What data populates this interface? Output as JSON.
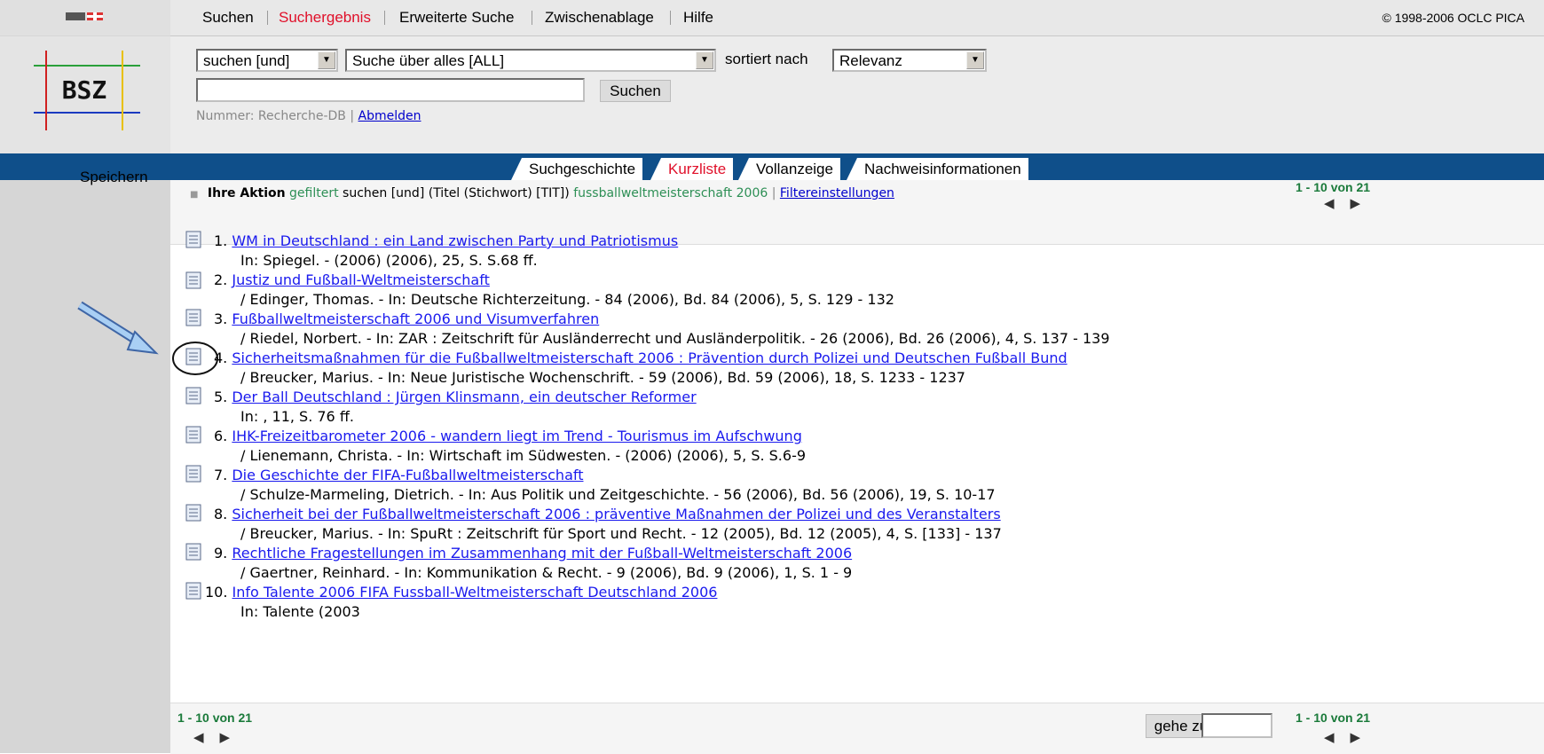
{
  "menu": {
    "items": [
      "Suchen",
      "Suchergebnis",
      "Erweiterte Suche",
      "Zwischenablage",
      "Hilfe"
    ],
    "copyright": "© 1998-2006 OCLC PICA"
  },
  "logo": {
    "text": "BSZ"
  },
  "search": {
    "mode_select": "suchen [und]",
    "index_select": "Suche über alles [ALL]",
    "sort_label": "sortiert nach",
    "sort_select": "Relevanz",
    "query_value": "",
    "search_button": "Suchen",
    "session_label": "Nummer: Recherche-DB |",
    "logout_link": "Abmelden"
  },
  "tabs": [
    "Suchgeschichte",
    "Kurzliste",
    "Vollanzeige",
    "Nachweisinformationen"
  ],
  "sidebar": {
    "save_label": "Speichern"
  },
  "action": {
    "label": "Ihre Aktion",
    "filtered": "gefiltert",
    "query_part": "suchen [und] (Titel (Stichwort) [TIT])",
    "query_term": "fussballweltmeisterschaft 2006",
    "filter_link": "Filtereinstellungen"
  },
  "pager": {
    "text": "1 - 10 von 21",
    "goto_button": "gehe zu",
    "goto_value": ""
  },
  "results": [
    {
      "num": "1.",
      "title": "WM in Deutschland : ein Land zwischen Party und Patriotismus",
      "sub": "In: Spiegel. - (2006) (2006), 25, S. S.68 ff."
    },
    {
      "num": "2.",
      "title": "Justiz und Fußball-Weltmeisterschaft",
      "sub": "/ Edinger, Thomas. - In: Deutsche Richterzeitung. - 84 (2006), Bd. 84 (2006), 5, S. 129 - 132"
    },
    {
      "num": "3.",
      "title": "Fußballweltmeisterschaft 2006 und Visumverfahren",
      "sub": "/ Riedel, Norbert. - In: ZAR : Zeitschrift für Ausländerrecht und Ausländerpolitik. - 26 (2006), Bd. 26 (2006), 4, S. 137 - 139"
    },
    {
      "num": "4.",
      "title": "Sicherheitsmaßnahmen für die Fußballweltmeisterschaft 2006 : Prävention durch Polizei und Deutschen Fußball Bund",
      "sub": "/ Breucker, Marius. - In: Neue Juristische Wochenschrift. - 59 (2006), Bd. 59 (2006), 18, S. 1233 - 1237"
    },
    {
      "num": "5.",
      "title": "Der Ball Deutschland : Jürgen Klinsmann, ein deutscher Reformer",
      "sub": "In: , 11, S. 76 ff."
    },
    {
      "num": "6.",
      "title": "IHK-Freizeitbarometer 2006 - wandern liegt im Trend - Tourismus im Aufschwung",
      "sub": "/ Lienemann, Christa. - In: Wirtschaft im Südwesten. - (2006) (2006), 5, S. S.6-9"
    },
    {
      "num": "7.",
      "title": "Die Geschichte der FIFA-Fußballweltmeisterschaft",
      "sub": "/ Schulze-Marmeling, Dietrich. - In: Aus Politik und Zeitgeschichte. - 56 (2006), Bd. 56 (2006), 19, S. 10-17"
    },
    {
      "num": "8.",
      "title": "Sicherheit bei der Fußballweltmeisterschaft 2006 : präventive Maßnahmen der Polizei und des Veranstalters",
      "sub": "/ Breucker, Marius. - In: SpuRt : Zeitschrift für Sport und Recht. - 12 (2005), Bd. 12 (2005), 4, S. [133] - 137"
    },
    {
      "num": "9.",
      "title": "Rechtliche Fragestellungen im Zusammenhang mit der Fußball-Weltmeisterschaft 2006",
      "sub": "/ Gaertner, Reinhard. - In: Kommunikation & Recht. - 9 (2006), Bd. 9 (2006), 1, S. 1 - 9"
    },
    {
      "num": "10.",
      "title": "Info Talente 2006 FIFA Fussball-Weltmeisterschaft Deutschland 2006",
      "sub": "In: Talente (2003"
    }
  ],
  "colors": {
    "accent_red": "#e0102a",
    "tabbar_blue": "#0f4f8a",
    "link_blue": "#1a1aee",
    "pager_green": "#1a7a3a"
  },
  "icons": {
    "result": "document-icon",
    "prev": "triangle-left-icon",
    "next": "triangle-right-icon",
    "annotation": "arrow-annotation"
  }
}
